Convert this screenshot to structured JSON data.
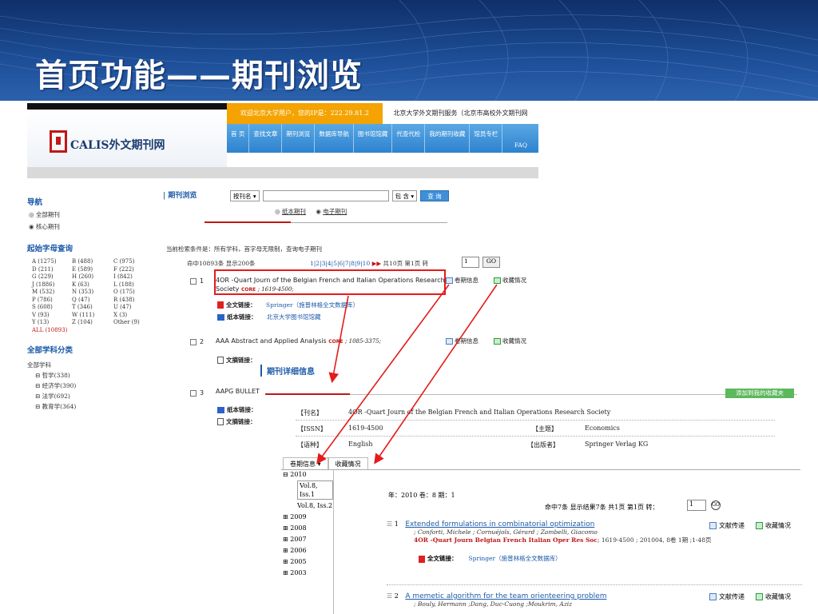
{
  "slide": {
    "title": "首页功能——期刊浏览"
  },
  "header": {
    "logo_text": "CALIS外文期刊网",
    "notice": "欢迎北京大学用户，您的IP是：222.29.81.2",
    "service": "北京大学外文期刊服务（北京市高校外文期刊网",
    "nav": [
      "首 页",
      "查找文章",
      "期刊浏览",
      "数据库导航",
      "图书馆馆藏",
      "代查代检",
      "我的期刊收藏",
      "馆员专栏"
    ],
    "faq": "FAQ"
  },
  "sidebar": {
    "nav_heading": "导航",
    "radios": [
      "全部期刊",
      "核心期刊"
    ],
    "letter_heading": "起始字母查询",
    "letters": [
      "A (1275)",
      "B (488)",
      "C (975)",
      "D (211)",
      "E (589)",
      "F (222)",
      "G (229)",
      "H (260)",
      "I (842)",
      "J (1886)",
      "K (63)",
      "L (188)",
      "M (532)",
      "N (353)",
      "O (175)",
      "P (786)",
      "Q (47)",
      "R (438)",
      "S (608)",
      "T (346)",
      "U (47)",
      "V (93)",
      "W (111)",
      "X (3)",
      "Y (13)",
      "Z (104)",
      "Other (9)"
    ],
    "all_letters": "ALL (10893)",
    "subject_heading": "全部学科分类",
    "subject_root": "全部学科",
    "subjects": [
      "哲学(338)",
      "经济学(390)",
      "法学(692)",
      "教育学(364)"
    ]
  },
  "browse": {
    "label": "期刊浏览",
    "field_select": "按刊名",
    "op_select": "包 含",
    "search_btn": "查 询",
    "type_paper": "纸本期刊",
    "type_electronic": "电子期刊",
    "conditions": "当前检索条件是：所有学科，首字母无限制，查询电子期刊",
    "hits": "命中10893条  显示200条",
    "pages": "1|2|3|4|5|6|7|8|9|10",
    "pager_tail": "共10页  第1页  转",
    "jump_value": "1",
    "go": "GO"
  },
  "records": [
    {
      "num": "1",
      "title": "4OR -Quart Journ of the Belgian French and Italian Operations Research Society",
      "core": "CORE",
      "issn": "; 1619-4500;",
      "fulltext_label": "全文链接：",
      "fulltext_value": "Springer（施普林格全文数据库）",
      "paper_label": "纸本链接：",
      "paper_value": "北京大学图书馆馆藏",
      "act1": "卷期信息",
      "act2": "收藏情况"
    },
    {
      "num": "2",
      "title": "AAA Abstract and Applied Analysis",
      "core": "CORE",
      "issn": "; 1085-3375;",
      "abstract_label": "文摘链接：",
      "act1": "卷期信息",
      "act2": "收藏情况"
    },
    {
      "num": "3",
      "title": "AAPG BULLET",
      "paper_label": "纸本链接：",
      "abstract_label": "文摘链接："
    }
  ],
  "detail": {
    "title": "期刊详细信息",
    "fav_button": "添加到我的收藏夹",
    "name_label": "【刊名】",
    "name_value": "4OR -Quart Journ of the Belgian French and Italian Operations Research Society",
    "issn_label": "【ISSN】",
    "issn_value": "1619-4500",
    "subject_label": "【主题】",
    "subject_value": "Economics",
    "lang_label": "【语种】",
    "lang_value": "English",
    "publisher_label": "【出版者】",
    "publisher_value": "Springer Verlag KG",
    "tab1": "卷期信息",
    "tab2": "收藏情况",
    "tree": {
      "y2010": "2010",
      "vol1": "Vol.8,  Iss.1",
      "vol2": "Vol.8,  Iss.2",
      "y2009": "2009",
      "y2008": "2008",
      "y2007": "2007",
      "y2006": "2006",
      "y2005": "2005",
      "y2003": "2003"
    },
    "year_label": "年：2010   卷：8  期：1",
    "list_meta": "命中7条  显示结果7条   共1页   第1页   转：",
    "jump_value": "1",
    "articles": [
      {
        "num": "1",
        "title": "Extended formulations in combinatorial optimization",
        "authors": "; Conforti, Michele ; Cornuéjols, Gérard ; Zambelli, Giacomo",
        "source": "4OR -Quart Journ Belgian French Italian Oper Res Soc",
        "source_tail": "; 1619-4500 ; 201004, 8卷 1期 ;1-48页",
        "fulltext_label": "全文链接：",
        "fulltext_value": "Springer（施普林格全文数据库）",
        "act1": "文献传递",
        "act2": "收藏情况"
      },
      {
        "num": "2",
        "title": "A memetic algorithm for the team orienteering problem",
        "authors": "; Bouly, Hermann ;Dang, Duc-Cuong ;Moukrim, Aziz",
        "act1": "文献传递",
        "act2": "收藏情况"
      }
    ]
  },
  "colors": {
    "banner": "#1d4f98",
    "highlight": "#e41b1b",
    "link": "#1c5aa8",
    "core": "#c01818"
  }
}
